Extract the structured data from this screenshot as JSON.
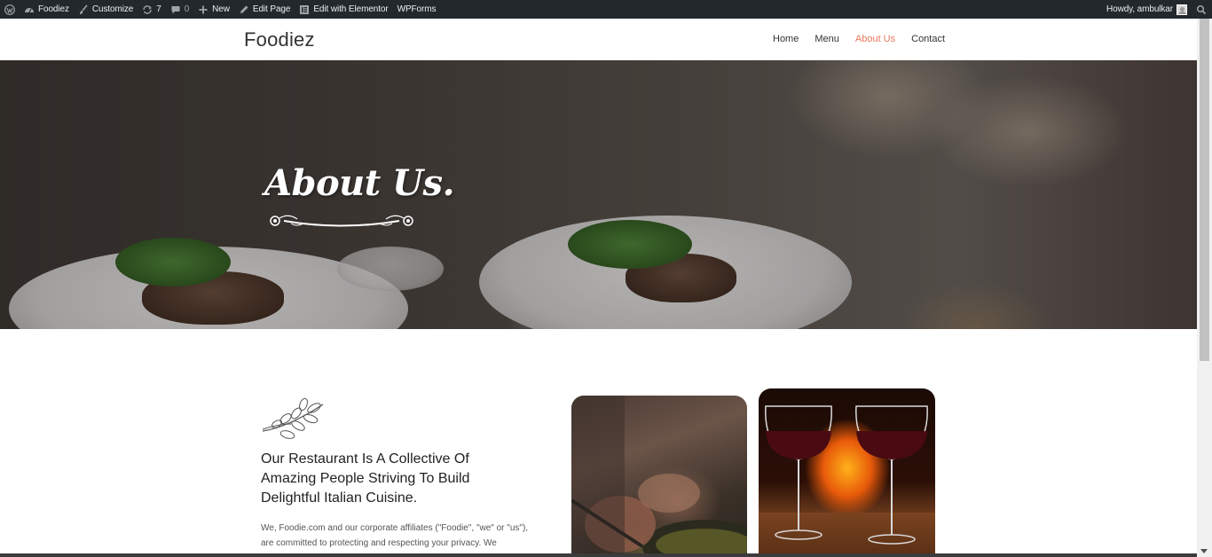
{
  "admin_bar": {
    "site_name": "Foodiez",
    "customize": "Customize",
    "updates_count": "7",
    "comments_count": "0",
    "new": "New",
    "edit_page": "Edit Page",
    "edit_elementor": "Edit with Elementor",
    "wpforms": "WPForms",
    "howdy": "Howdy, ambulkar"
  },
  "header": {
    "logo": "Foodiez",
    "nav": [
      {
        "label": "Home"
      },
      {
        "label": "Menu"
      },
      {
        "label": "About Us",
        "active": true
      },
      {
        "label": "Contact"
      }
    ]
  },
  "hero": {
    "title": "About Us."
  },
  "content": {
    "heading": "Our Restaurant Is A Collective Of Amazing People Striving To Build Delightful Italian Cuisine.",
    "paragraph": "We, Foodie.com and our corporate affiliates (\"Foodie\", \"we\" or \"us\"), are committed to protecting and respecting your privacy. We"
  },
  "colors": {
    "accent": "#e8785c",
    "admin_bar_bg": "#23282d",
    "text_dark": "#222222"
  }
}
